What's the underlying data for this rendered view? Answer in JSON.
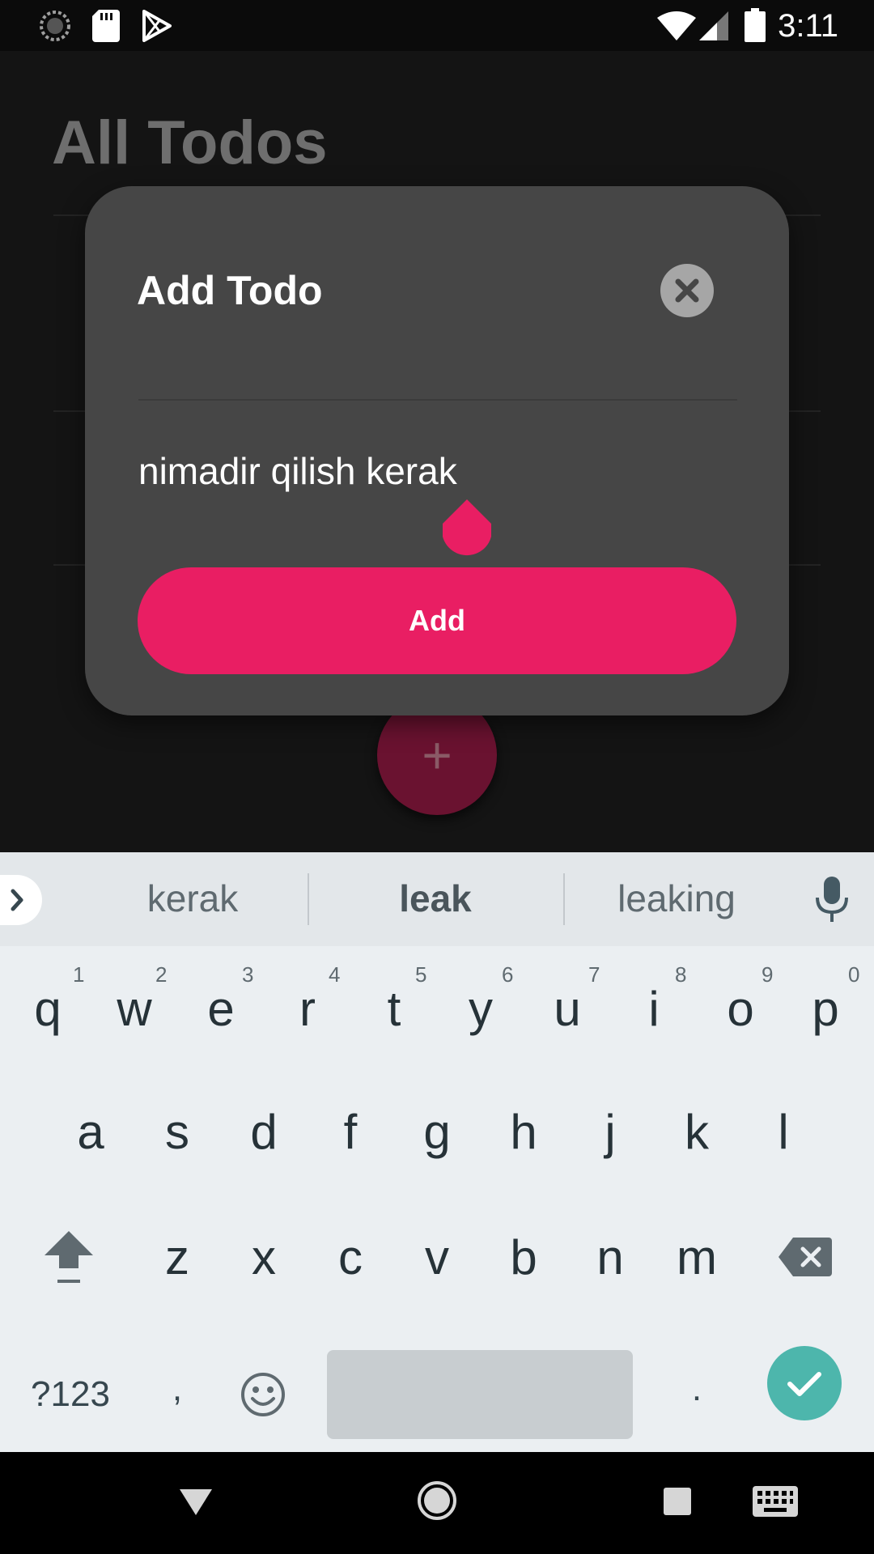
{
  "status_bar": {
    "time": "3:11",
    "icons_left": [
      "sync-icon",
      "sd-card-icon",
      "play-store-icon"
    ],
    "icons_right": [
      "wifi-icon",
      "signal-icon",
      "battery-icon"
    ]
  },
  "app": {
    "title": "All Todos",
    "fab_label": "+"
  },
  "dialog": {
    "title": "Add Todo",
    "input_value": "nimadir qilish kerak",
    "add_button_label": "Add",
    "accent_color": "#e91e63"
  },
  "keyboard": {
    "suggestions": [
      "kerak",
      "leak",
      "leaking"
    ],
    "highlighted_suggestion": "leak",
    "row1": [
      "q",
      "w",
      "e",
      "r",
      "t",
      "y",
      "u",
      "i",
      "o",
      "p"
    ],
    "row1_hints": [
      "1",
      "2",
      "3",
      "4",
      "5",
      "6",
      "7",
      "8",
      "9",
      "0"
    ],
    "row2": [
      "a",
      "s",
      "d",
      "f",
      "g",
      "h",
      "j",
      "k",
      "l"
    ],
    "row3": [
      "z",
      "x",
      "c",
      "v",
      "b",
      "n",
      "m"
    ],
    "symbols_label": "?123",
    "comma_label": ",",
    "period_label": ".",
    "enter_color": "#4db6ac"
  },
  "nav_bar": {
    "buttons": [
      "back-icon",
      "home-icon",
      "recents-icon",
      "keyboard-switch-icon"
    ]
  }
}
